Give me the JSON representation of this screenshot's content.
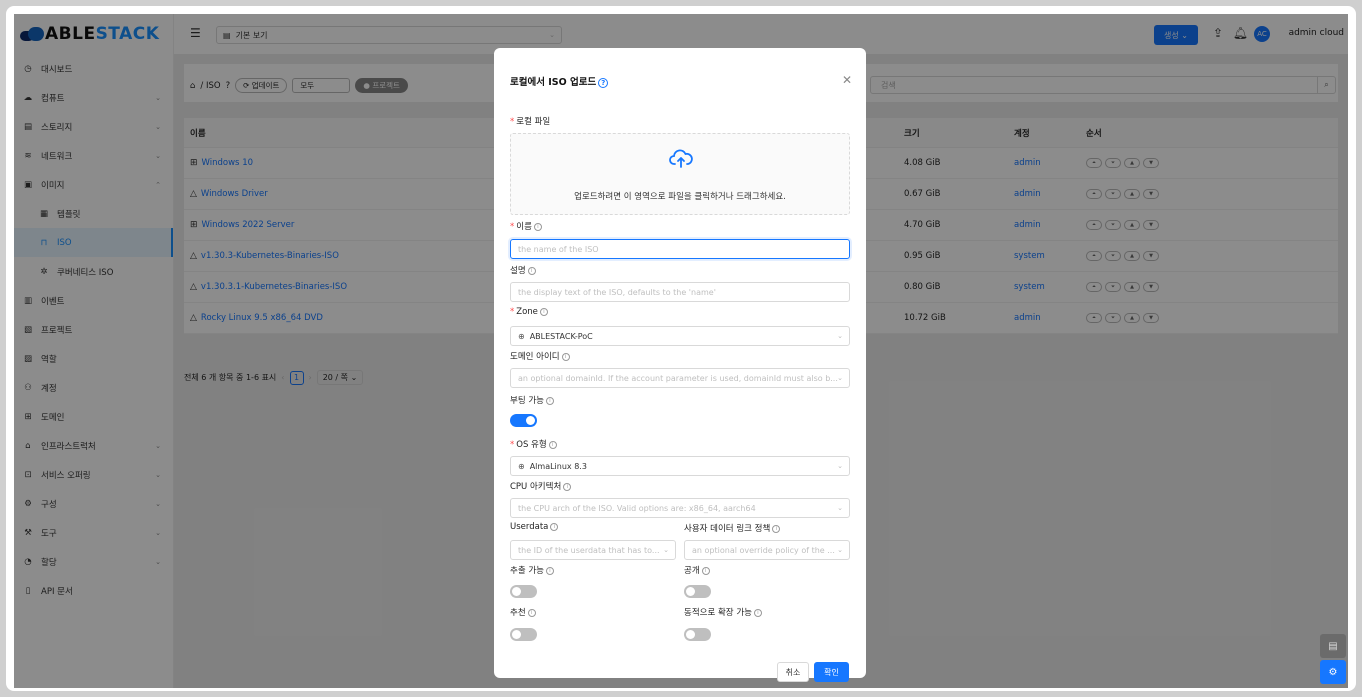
{
  "brand": {
    "name_a": "ABLE",
    "name_b": "STACK"
  },
  "sidebar": {
    "items": [
      {
        "label": "대시보드",
        "icon": "dashboard-icon",
        "arrow": ""
      },
      {
        "label": "컴퓨트",
        "icon": "cloud-icon",
        "arrow": "⌄"
      },
      {
        "label": "스토리지",
        "icon": "storage-icon",
        "arrow": "⌄"
      },
      {
        "label": "네트워크",
        "icon": "wifi-icon",
        "arrow": "⌄"
      },
      {
        "label": "이미지",
        "icon": "image-icon",
        "arrow": "⌃"
      },
      {
        "label": "템플릿",
        "icon": "template-icon",
        "arrow": "",
        "sub": true
      },
      {
        "label": "ISO",
        "icon": "iso-icon",
        "arrow": "",
        "sub": true,
        "active": true
      },
      {
        "label": "쿠버네티스 ISO",
        "icon": "kubernetes-icon",
        "arrow": "",
        "sub": true
      },
      {
        "label": "이벤트",
        "icon": "event-icon",
        "arrow": ""
      },
      {
        "label": "프로젝트",
        "icon": "project-icon",
        "arrow": ""
      },
      {
        "label": "역할",
        "icon": "role-icon",
        "arrow": ""
      },
      {
        "label": "계정",
        "icon": "users-icon",
        "arrow": ""
      },
      {
        "label": "도메인",
        "icon": "domain-icon",
        "arrow": ""
      },
      {
        "label": "인프라스트럭처",
        "icon": "bank-icon",
        "arrow": "⌄"
      },
      {
        "label": "서비스 오퍼링",
        "icon": "shopping-icon",
        "arrow": "⌄"
      },
      {
        "label": "구성",
        "icon": "settings-icon",
        "arrow": "⌄"
      },
      {
        "label": "도구",
        "icon": "tool-icon",
        "arrow": "⌄"
      },
      {
        "label": "할당",
        "icon": "pie-icon",
        "arrow": "⌄"
      },
      {
        "label": "API 문서",
        "icon": "book-icon",
        "arrow": ""
      }
    ]
  },
  "topbar": {
    "view_select": "기본 보기",
    "create_label": "생성",
    "avatar_initials": "AC",
    "user": "admin cloud"
  },
  "toolbar": {
    "breadcrumb": "/ ISO",
    "update": "업데이트",
    "filter_value": "모두",
    "project": "프로젝트",
    "search_placeholder": "검색"
  },
  "table": {
    "headers": {
      "name": "이름",
      "size": "크기",
      "account": "계정",
      "order": "순서"
    },
    "rows": [
      {
        "name": "Windows 10",
        "os": "windows",
        "size": "4.08 GiB",
        "account": "admin"
      },
      {
        "name": "Windows Driver",
        "os": "linux",
        "size": "0.67 GiB",
        "account": "admin"
      },
      {
        "name": "Windows 2022 Server",
        "os": "windows",
        "size": "4.70 GiB",
        "account": "admin"
      },
      {
        "name": "v1.30.3-Kubernetes-Binaries-ISO",
        "os": "linux",
        "size": "0.95 GiB",
        "account": "system"
      },
      {
        "name": "v1.30.3.1-Kubernetes-Binaries-ISO",
        "os": "linux",
        "size": "0.80 GiB",
        "account": "system"
      },
      {
        "name": "Rocky Linux 9.5 x86_64 DVD",
        "os": "linux",
        "size": "10.72 GiB",
        "account": "admin"
      }
    ]
  },
  "pagination": {
    "summary": "전체 6 개 항목 중 1-6 표시",
    "page": "1",
    "page_size": "20 / 쪽"
  },
  "modal": {
    "title": "로컬에서 ISO 업로드",
    "local_file_label": "로컬 파일",
    "upload_hint": "업로드하려면 이 영역으로 파일을 클릭하거나 드래그하세요.",
    "name_label": "이름",
    "name_placeholder": "the name of the ISO",
    "desc_label": "설명",
    "desc_placeholder": "the display text of the ISO, defaults to the 'name'",
    "zone_label": "Zone",
    "zone_value": "ABLESTACK-PoC",
    "domain_label": "도메인 아이디",
    "domain_placeholder": "an optional domainId. If the account parameter is used, domainId must also b...",
    "bootable_label": "부팅 가능",
    "bootable_on": true,
    "os_label": "OS 유형",
    "os_value": "AlmaLinux 8.3",
    "cpu_label": "CPU 아키텍처",
    "cpu_placeholder": "the CPU arch of the ISO. Valid options are: x86_64, aarch64",
    "userdata_label": "Userdata",
    "userdata_placeholder": "the ID of the userdata that has to...",
    "userdata_policy_label": "사용자 데이터 링크 정책",
    "userdata_policy_placeholder": "an optional override policy of the ...",
    "extractable_label": "추출 가능",
    "public_label": "공개",
    "featured_label": "추천",
    "dynamic_label": "동적으로 확장 가능",
    "cancel": "취소",
    "ok": "확인"
  },
  "colors": {
    "accent": "#1677ff",
    "required": "#ff4d4f"
  }
}
